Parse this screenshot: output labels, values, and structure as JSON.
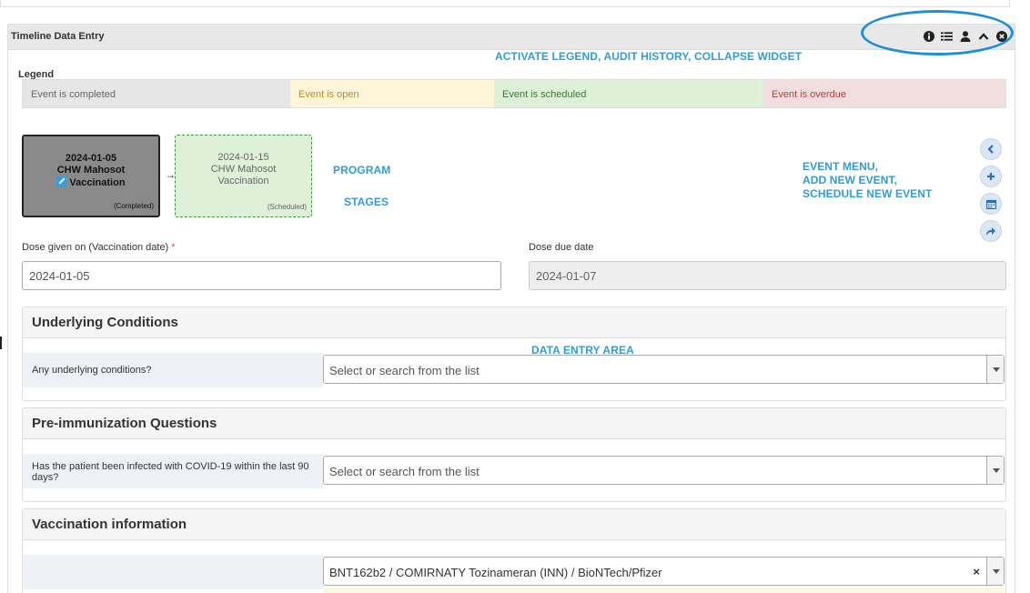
{
  "widget": {
    "title": "Timeline Data Entry",
    "tools": [
      "info-icon",
      "list-icon",
      "user-icon",
      "chevron-up-icon",
      "close-circle-icon"
    ]
  },
  "annotations": {
    "widget_tools": "ACTIVATE LEGEND, AUDIT HISTORY, COLLAPSE WIDGET",
    "program_stages_line1": "PROGRAM",
    "program_stages_line2": "STAGES",
    "event_menu_line1": "EVENT MENU,",
    "event_menu_line2": "ADD NEW EVENT,",
    "event_menu_line3": "SCHEDULE NEW  EVENT",
    "data_entry_area": "DATA ENTRY AREA"
  },
  "legend": {
    "label": "Legend",
    "completed": "Event is completed",
    "open": "Event is open",
    "scheduled": "Event is scheduled",
    "overdue": "Event is overdue",
    "colors": {
      "completed": "#e6e6e6",
      "open": "#fff6d9",
      "scheduled": "#dff0d8",
      "overdue": "#f2dede"
    }
  },
  "stages": [
    {
      "date": "2024-01-05",
      "org_unit": "CHW Mahosot",
      "name": "Vaccination",
      "status": "(Completed)"
    },
    {
      "date": "2024-01-15",
      "org_unit": "CHW Mahosot",
      "name": "Vaccination",
      "status": "(Scheduled)"
    }
  ],
  "event_menu": [
    "chevron-left-icon",
    "plus-icon",
    "calendar-icon",
    "share-arrow-icon"
  ],
  "dates": {
    "given_label": "Dose given on (Vaccination date)",
    "required_mark": "*",
    "given_value": "2024-01-05",
    "due_label": "Dose due date",
    "due_value": "2024-01-07"
  },
  "sections": [
    {
      "title": "Underlying Conditions",
      "question": "Any underlying conditions?",
      "placeholder": "Select or search from the list"
    },
    {
      "title": "Pre-immunization Questions",
      "question": "Has the patient been infected with COVID-19 within the last 90 days?",
      "placeholder": "Select or search from the list"
    },
    {
      "title": "Vaccination information",
      "question": "",
      "value": "BNT162b2 / COMIRNATY Tozinameran (INN) / BioNTech/Pfizer",
      "clear": "×"
    }
  ]
}
